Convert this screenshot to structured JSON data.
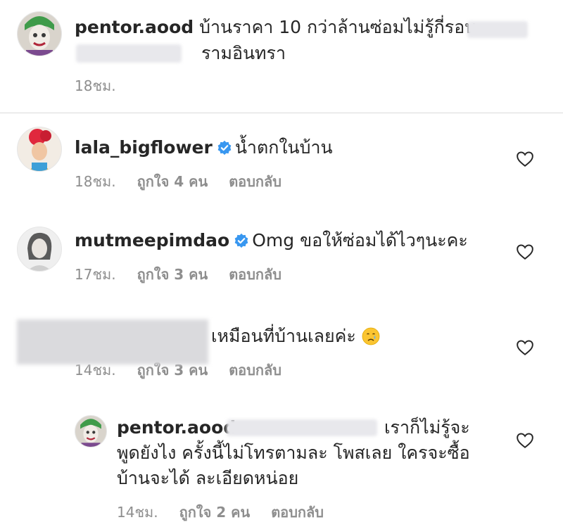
{
  "thread": {
    "original_post": {
      "username": "pentor.aood",
      "text_part1": "บ้านราคา 10 กว่าล้านซ่อมไม่รู้กี่รอบ",
      "text_part2": "รามอินทรา",
      "time": "18ชม."
    },
    "comments": [
      {
        "username": "lala_bigflower",
        "text": "น้ำตกในบ้าน",
        "time": "18ชม.",
        "likes": "ถูกใจ 4 คน",
        "reply_label": "ตอบกลับ"
      },
      {
        "username": "mutmeepimdao",
        "text": "Omg ขอให้ซ่อมได้ไวๆนะคะ",
        "time": "17ชม.",
        "likes": "ถูกใจ 3 คน",
        "reply_label": "ตอบกลับ"
      },
      {
        "text": "เหมือนที่บ้านเลยค่ะ",
        "time": "14ชม.",
        "likes": "ถูกใจ 3 คน",
        "reply_label": "ตอบกลับ"
      }
    ],
    "reply": {
      "username": "pentor.aood",
      "text_line1": "เราก็ไม่รู้จะ",
      "text_line2": "พูดยังไง ครั้งนี้ไม่โทรตามละ โพสเลย ใครจะซื้อ",
      "text_line3": "บ้านจะได้ ละเอียดหน่อย",
      "time": "14ชม.",
      "likes": "ถูกใจ 2 คน",
      "reply_label": "ตอบกลับ"
    }
  },
  "icons": {
    "heart": "heart-outline-icon",
    "verified": "verified-badge-icon",
    "emoji": "crying-face-emoji"
  },
  "colors": {
    "text": "#262626",
    "meta": "#8e8e8e",
    "verified": "#3897f0",
    "divider": "#dbdbdb"
  }
}
